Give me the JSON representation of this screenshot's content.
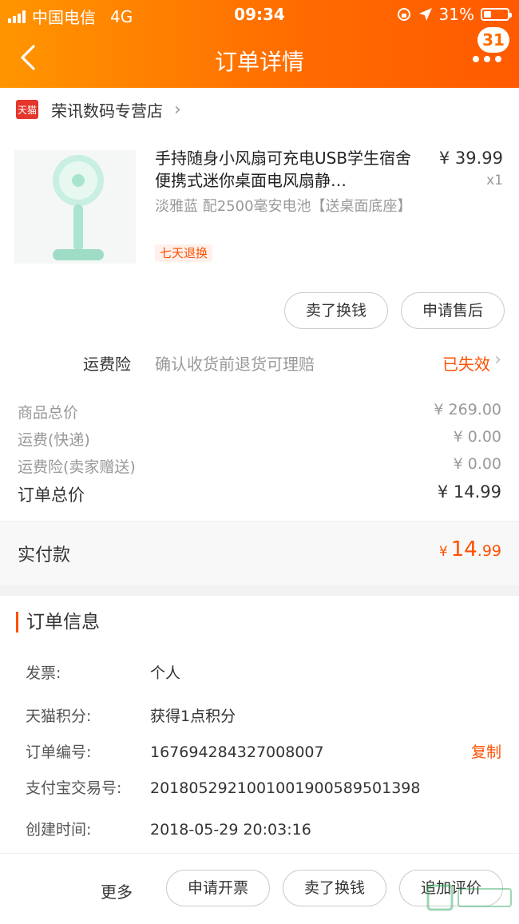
{
  "status_bar": {
    "carrier": "中国电信",
    "network": "4G",
    "time": "09:34",
    "battery": "31%",
    "battery_level": 0.31
  },
  "nav": {
    "title": "订单详情",
    "badge": "31"
  },
  "store": {
    "name": "荣讯数码专营店",
    "tmall_label": "天猫"
  },
  "product": {
    "title": "手持随身小风扇可充电USB学生宿舍便携式迷你桌面电风扇静…",
    "spec": "淡雅蓝  配2500毫安电池【送桌面底座】",
    "tag": "七天退换",
    "price": "¥ 39.99",
    "qty": "x1"
  },
  "item_actions": {
    "sell": "卖了换钱",
    "after_sale": "申请售后"
  },
  "insurance": {
    "label": "运费险",
    "desc": "确认收货前退货可理赔",
    "status": "已失效"
  },
  "costs": [
    {
      "label": "商品总价",
      "value": "¥ 269.00"
    },
    {
      "label": "运费(快递)",
      "value": "¥ 0.00"
    },
    {
      "label": "运费险(卖家赠送)",
      "value": "¥ 0.00"
    }
  ],
  "total": {
    "label": "订单总价",
    "value": "¥ 14.99"
  },
  "paid": {
    "label": "实付款",
    "symbol": "¥",
    "int": "14",
    "dec": ".99"
  },
  "order_info": {
    "title": "订单信息",
    "rows": [
      {
        "k": "发票:",
        "v": "个人"
      },
      {
        "k": "天猫积分:",
        "v": "获得1点积分"
      },
      {
        "k": "订单编号:",
        "v": "167694284327008007"
      },
      {
        "k": "支付宝交易号:",
        "v": "2018052921001001900589501398"
      },
      {
        "k": "创建时间:",
        "v": "2018-05-29 20:03:16"
      }
    ],
    "copy": "复制"
  },
  "bottom_bar": {
    "more": "更多",
    "invoice": "申请开票",
    "sell": "卖了换钱",
    "review": "追加评价"
  },
  "colors": {
    "accent": "#ff5000",
    "header_start": "#ff9500",
    "header_end": "#ff5a00"
  }
}
